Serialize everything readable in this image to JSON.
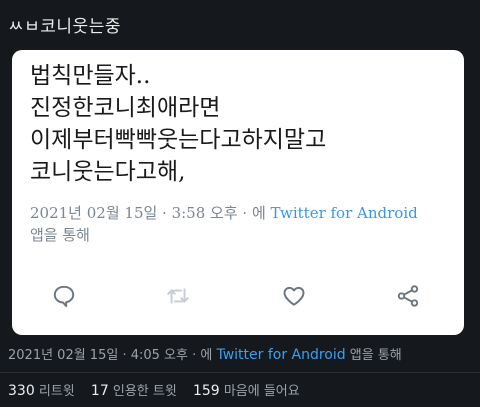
{
  "header": {
    "title": "ㅆㅂ코니웃는중"
  },
  "tweet_card": {
    "lines": [
      "법칙만들자..",
      "진정한코니최애라면",
      "이제부터빡빡웃는다고하지말고",
      "코니웃는다고해,"
    ],
    "timestamp": "2021년 02월 15일 · 3:58 오후 · 에",
    "source": "Twitter for Android",
    "source_suffix": "앱을 통해",
    "actions": {
      "reply_icon": "comment-icon",
      "retweet_icon": "retweet-icon",
      "like_icon": "heart-icon",
      "share_icon": "share-icon"
    }
  },
  "outer_tweet": {
    "timestamp": "2021년 02월 15일 · 4:05 오후 · 에",
    "source": "Twitter for Android",
    "source_suffix": "앱을 통해"
  },
  "stats": {
    "retweets_count": "330",
    "retweets_label": "리트윗",
    "quotes_count": "17",
    "quotes_label": "인용한 트윗",
    "likes_count": "159",
    "likes_label": "마음에 들어요"
  },
  "colors": {
    "background": "#15181c",
    "link": "#3aa0f2",
    "card": "#ffffff"
  }
}
